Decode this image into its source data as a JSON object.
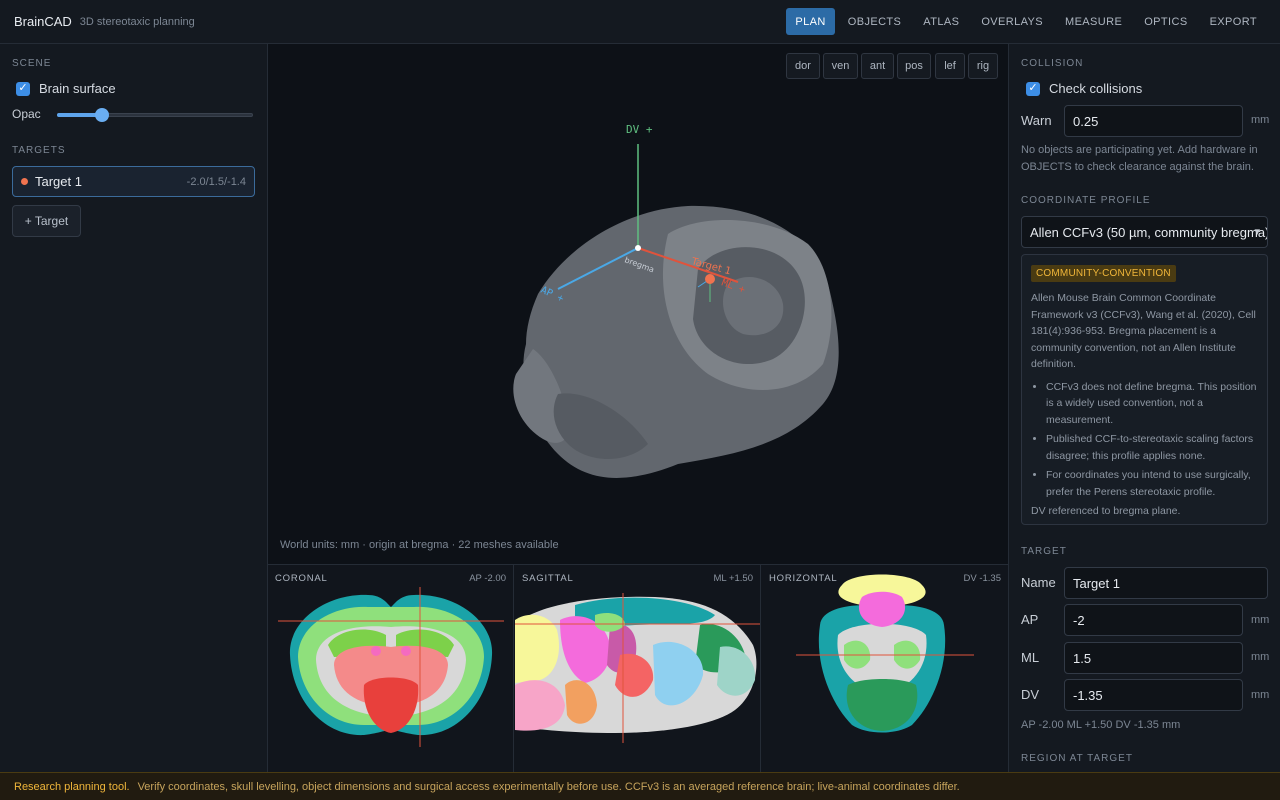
{
  "app": {
    "title": "BrainCAD",
    "subtitle": "3D stereotaxic planning"
  },
  "nav": {
    "items": [
      "PLAN",
      "OBJECTS",
      "ATLAS",
      "OVERLAYS",
      "MEASURE",
      "OPTICS",
      "EXPORT"
    ],
    "active": "PLAN"
  },
  "scene": {
    "section": "SCENE",
    "brain_surface_label": "Brain surface",
    "brain_surface_checked": true,
    "opacity_label": "Opac",
    "opacity_value": 0.23
  },
  "targets": {
    "section": "TARGETS",
    "items": [
      {
        "name": "Target 1",
        "coords": "-2.0/1.5/-1.4",
        "color": "#f0734f"
      }
    ],
    "add_label": "+ Target"
  },
  "viewport": {
    "view_buttons": [
      "dor",
      "ven",
      "ant",
      "pos",
      "lef",
      "rig"
    ],
    "axis_dv": "DV +",
    "axis_ap": "AP +",
    "axis_ml": "ML +",
    "origin_label": "bregma",
    "target_label": "Target 1",
    "footnote": "World units: mm · origin at bregma · 22 meshes available"
  },
  "slices": {
    "coronal": {
      "label": "CORONAL",
      "value": "AP -2.00"
    },
    "sagittal": {
      "label": "SAGITTAL",
      "value": "ML +1.50"
    },
    "horizontal": {
      "label": "HORIZONTAL",
      "value": "DV -1.35"
    }
  },
  "collision": {
    "section": "COLLISION",
    "check_label": "Check collisions",
    "checked": true,
    "warn_label": "Warn",
    "warn_value": "0.25",
    "unit": "mm",
    "note": "No objects are participating yet. Add hardware in OBJECTS to check clearance against the brain."
  },
  "profile": {
    "section": "COORDINATE PROFILE",
    "selected": "Allen CCFv3 (50 µm, community bregma)",
    "badge": "COMMUNITY-CONVENTION",
    "description": "Allen Mouse Brain Common Coordinate Framework v3 (CCFv3), Wang et al. (2020), Cell 181(4):936-953. Bregma placement is a community convention, not an Allen Institute definition.",
    "bullets": [
      "CCFv3 does not define bregma. This position is a widely used convention, not a measurement.",
      "Published CCF-to-stereotaxic scaling factors disagree; this profile applies none.",
      "For coordinates you intend to use surgically, prefer the Perens stereotaxic profile."
    ],
    "dv_note": "DV referenced to bregma plane."
  },
  "target": {
    "section": "TARGET",
    "name_label": "Name",
    "name_value": "Target 1",
    "ap_label": "AP",
    "ap_value": "-2",
    "ml_label": "ML",
    "ml_value": "1.5",
    "dv_label": "DV",
    "dv_value": "-1.35",
    "unit": "mm",
    "summary": "AP -2.00 ML +1.50 DV -1.35 mm"
  },
  "region": {
    "section": "REGION AT TARGET"
  },
  "footer": {
    "strong": "Research planning tool.",
    "text": "Verify coordinates, skull levelling, object dimensions and surgical access experimentally before use. CCFv3 is an averaged reference brain; live-animal coordinates differ."
  }
}
